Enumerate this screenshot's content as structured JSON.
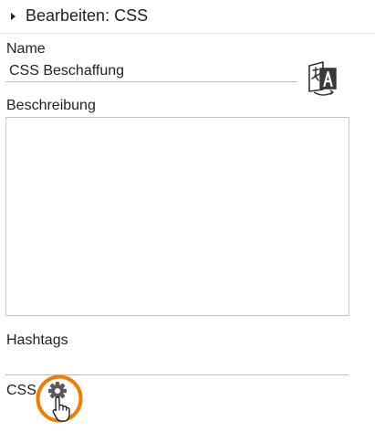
{
  "header": {
    "title": "Bearbeiten: CSS"
  },
  "name_field": {
    "label": "Name",
    "value": "CSS Beschaffung"
  },
  "translate_button": {
    "icon": "translate-icon"
  },
  "description_field": {
    "label": "Beschreibung",
    "value": ""
  },
  "hashtags_field": {
    "label": "Hashtags",
    "value": ""
  },
  "css_field": {
    "label": "CSS",
    "icon": "gear-icon",
    "highlight_color": "#ef7d00"
  },
  "colors": {
    "text": "#222222",
    "underline": "#bdbdbd",
    "highlight": "#ef7d00"
  }
}
